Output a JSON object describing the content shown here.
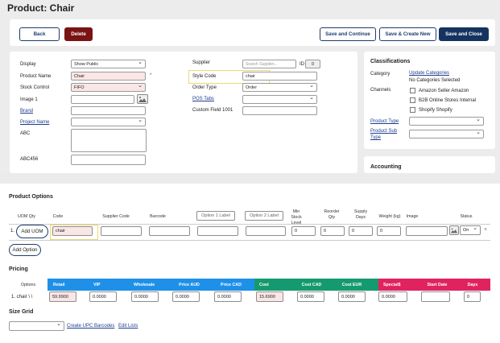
{
  "page": {
    "title": "Product: Chair"
  },
  "toolbar": {
    "back": "Back",
    "delete": "Delete",
    "save_continue": "Save and Continue",
    "save_create_new": "Save & Create New",
    "save_close": "Save and Close"
  },
  "form": {
    "display": {
      "label": "Display",
      "value": "Show Public"
    },
    "product_name": {
      "label": "Product Name",
      "value": "Chair",
      "marker": "*"
    },
    "stock_control": {
      "label": "Stock Control",
      "value": "FIFO"
    },
    "image1": {
      "label": "Image 1"
    },
    "brand": {
      "label": "Brand"
    },
    "project_name": {
      "label": "Project Name"
    },
    "abc": {
      "label": "ABC"
    },
    "abc456": {
      "label": "ABC456"
    },
    "supplier": {
      "label": "Supplier",
      "placeholder": "Search Supplier...",
      "id_label": "ID",
      "id_value": "0"
    },
    "style_code": {
      "label": "Style Code",
      "value": "chair"
    },
    "order_type": {
      "label": "Order Type",
      "value": "Order"
    },
    "pos_tabs": {
      "label": "POS Tabs"
    },
    "custom_field": {
      "label": "Custom Field 1001"
    }
  },
  "classifications": {
    "title": "Classifications",
    "category_label": "Category",
    "update_link": "Update Categories",
    "no_categories": "No Categories Selected",
    "channels_label": "Channels",
    "channels": [
      "Amazon Seller Amazon",
      "B2B Online Stores Internal",
      "Shopify Shopify"
    ],
    "product_type": "Product Type",
    "product_sub_type_1": "Product Sub",
    "product_sub_type_2": "Type"
  },
  "accounting": {
    "title": "Accounting"
  },
  "product_options": {
    "title": "Product Options",
    "headers": {
      "uom_qty": "UOM Qty",
      "code": "Code",
      "supplier_code": "Supplier Code",
      "barcode": "Barcode",
      "option1": "Option 1 Label",
      "option2": "Option 2 Label",
      "min_stock_1": "Min Stock",
      "min_stock_2": "Level",
      "reorder_1": "Reorder",
      "reorder_2": "Qty",
      "supply_1": "Supply",
      "supply_2": "Days",
      "weight": "Weight (kg)",
      "image": "Image",
      "status": "Status"
    },
    "row": {
      "num": "1.",
      "add_uom": "Add UOM",
      "code": "chair",
      "min_stock": "0",
      "reorder": "0",
      "supply": "0",
      "weight": "0",
      "status": "On",
      "remove": "×"
    },
    "add_option": "Add Option"
  },
  "pricing": {
    "title": "Pricing",
    "headers": {
      "options": "Options",
      "retail": "Retail",
      "vip": "VIP",
      "wholesale": "Wholesale",
      "price_aud": "Price AUD",
      "price_cad": "Price CAD",
      "cost": "Cost",
      "cost_cad": "Cost CAD",
      "cost_eur": "Cost EUR",
      "special": "Special$",
      "start_date": "Start Date",
      "days": "Days"
    },
    "row": {
      "label": "1.  chair \\ \\",
      "retail": "59.9900",
      "vip": "0.0000",
      "wholesale": "0.0000",
      "price_aud": "0.0000",
      "price_cad": "0.0000",
      "cost": "15.6900",
      "cost_cad": "0.0000",
      "cost_eur": "0.0000",
      "special": "0.0000",
      "days": "0"
    }
  },
  "size_grid": {
    "title": "Size Grid",
    "create_upc": "Create UPC Barcodes",
    "edit_lists": "Edit Lists"
  },
  "colors": {
    "retail_band": "#1e90e8",
    "cost_band": "#149a6e",
    "special_band": "#e0235f",
    "navy": "#15335f",
    "delete": "#7a1414"
  }
}
